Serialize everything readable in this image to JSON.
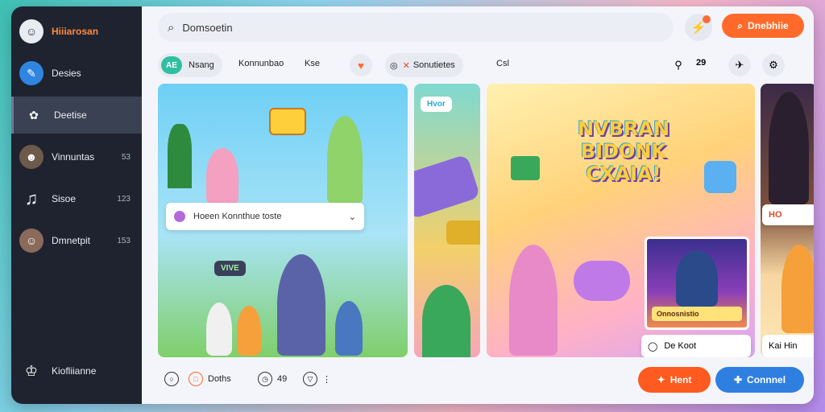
{
  "sidebar": {
    "items": [
      {
        "label": "Hiiiarosan",
        "count": "",
        "color": "#e9ecf2",
        "icon": "user-avatar"
      },
      {
        "label": "Desies",
        "count": "",
        "color": "#2f86e0",
        "icon": "chat-icon"
      },
      {
        "label": "Deetise",
        "count": "",
        "color": "#3a4152",
        "icon": "brain-icon"
      },
      {
        "label": "Vinnuntas",
        "count": "53",
        "color": "#6d5a4a",
        "icon": "group-avatar"
      },
      {
        "label": "Sisoe",
        "count": "123",
        "color": "#1f2330",
        "icon": "music-note-icon"
      },
      {
        "label": "Dmnetpit",
        "count": "153",
        "color": "#8a6a5a",
        "icon": "user-avatar"
      }
    ],
    "footer": {
      "label": "Kiofliianne",
      "icon": "logo-icon"
    }
  },
  "topbar": {
    "search_value": "Domsoetin",
    "primary_label": "Dnebhiie"
  },
  "tabs": {
    "chip_badge": "AE",
    "chip_label": "Nsang",
    "tab1": "Konnunbao",
    "tab2": "Kse",
    "chip2_label": "Sonutietes",
    "tab3": "Csl",
    "counter": "29"
  },
  "content": {
    "dropdown_label": "Hoeen Konnthue toste",
    "p2_tag": "Hvor",
    "poster_title_line1": "NVBRAN",
    "poster_title_line2": "BIDONK",
    "poster_title_line3": "CXAIA!",
    "poster_small_sign": "VIVE",
    "caption_label": "Onnosnistio",
    "subchip_label": "De Koot",
    "p4_tag": "HO",
    "p4_label": "Kai Hin"
  },
  "bottombar": {
    "item1_label": "Doths",
    "item2_label": "49",
    "next_label": "Hent",
    "connect_label": "Connnel"
  },
  "colors": {
    "accent": "#ff6a2a",
    "connect": "#2f7fe0",
    "sidebar_bg": "#1f2330"
  }
}
